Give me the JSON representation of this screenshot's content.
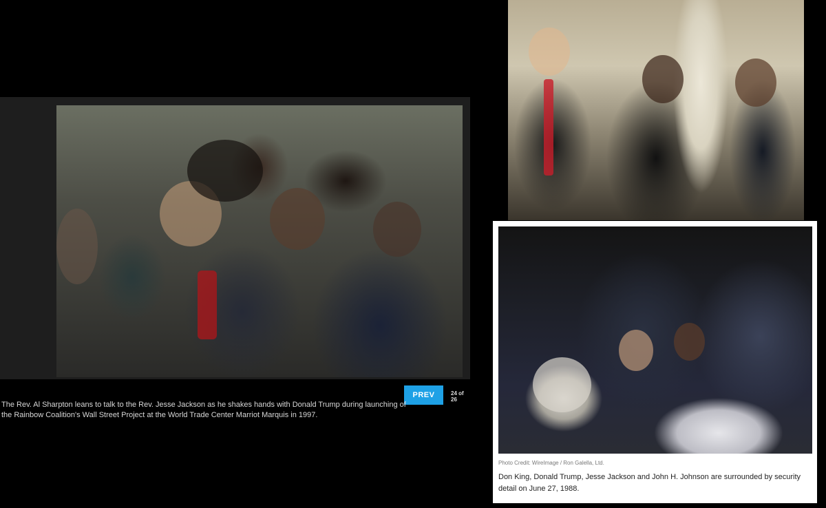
{
  "left_panel": {
    "caption": "The Rev. Al Sharpton leans to talk to the Rev. Jesse Jackson as he shakes hands with Donald Trump during launching of the Rainbow Coalition's Wall Street Project at the World Trade Center Marriot Marquis in 1997.",
    "prev_label": "PREV",
    "counter": "24 of 26",
    "accent_color": "#1ea1e6"
  },
  "right_card": {
    "photo_credit": "Photo Credit: WireImage / Ron Galella, Ltd.",
    "caption": "Don King, Donald Trump, Jesse Jackson and John H. Johnson are surrounded by security detail on June 27, 1988."
  }
}
